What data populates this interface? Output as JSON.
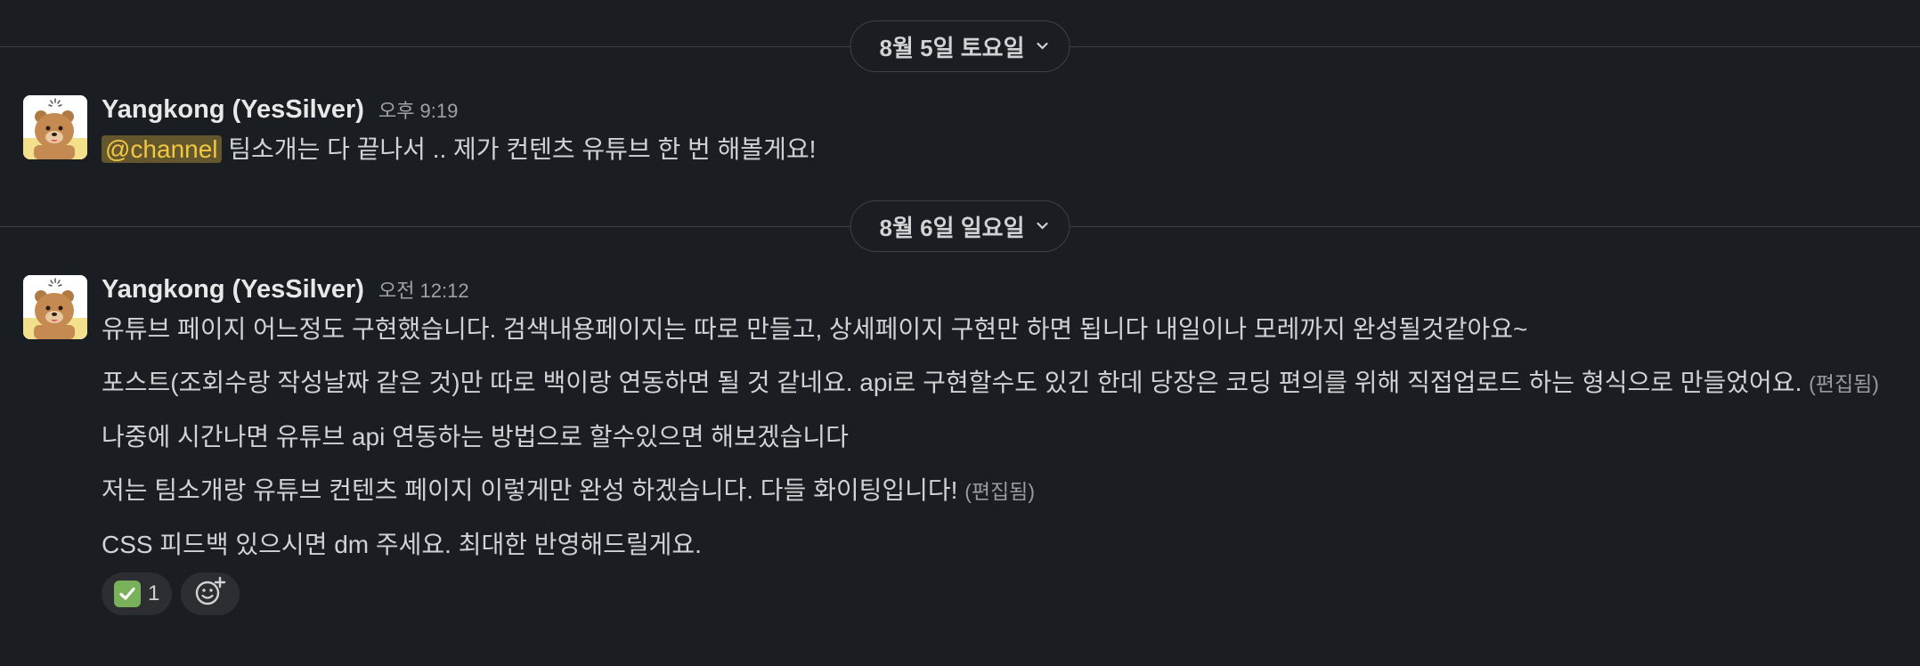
{
  "dividers": [
    {
      "label": "8월 5일 토요일"
    },
    {
      "label": "8월 6일 일요일"
    }
  ],
  "messages": [
    {
      "author": "Yangkong (YesSilver)",
      "time": "오후 9:19",
      "mention": "@channel",
      "text": " 팀소개는 다 끝나서 .. 제가 컨텐츠 유튜브 한 번 해볼게요!"
    },
    {
      "author": "Yangkong (YesSilver)",
      "time": "오전 12:12",
      "paragraphs": [
        {
          "text": "유튜브 페이지 어느정도 구현했습니다. 검색내용페이지는 따로 만들고, 상세페이지 구현만 하면 됩니다 내일이나 모레까지 완성될것같아요~",
          "edited": ""
        },
        {
          "text": "포스트(조회수랑 작성날짜 같은 것)만 따로 백이랑 연동하면 될 것 같네요. api로 구현할수도 있긴 한데 당장은 코딩 편의를 위해 직접업로드 하는 형식으로 만들었어요.",
          "edited": "(편집됨)"
        },
        {
          "text": "나중에 시간나면 유튜브 api 연동하는 방법으로 할수있으면 해보겠습니다",
          "edited": ""
        },
        {
          "text": "저는 팀소개랑 유튜브 컨텐츠 페이지 이렇게만 완성 하겠습니다. 다들 화이팅입니다!",
          "edited": "(편집됨)"
        },
        {
          "text": "CSS 피드백 있으시면 dm 주세요. 최대한 반영해드릴게요.",
          "edited": ""
        }
      ],
      "reactions": [
        {
          "icon": "white-check-mark-emoji",
          "count": "1"
        }
      ]
    }
  ],
  "colors": {
    "background": "#1a1d21",
    "mention_text": "#f2c744",
    "check_green": "#78b159"
  }
}
